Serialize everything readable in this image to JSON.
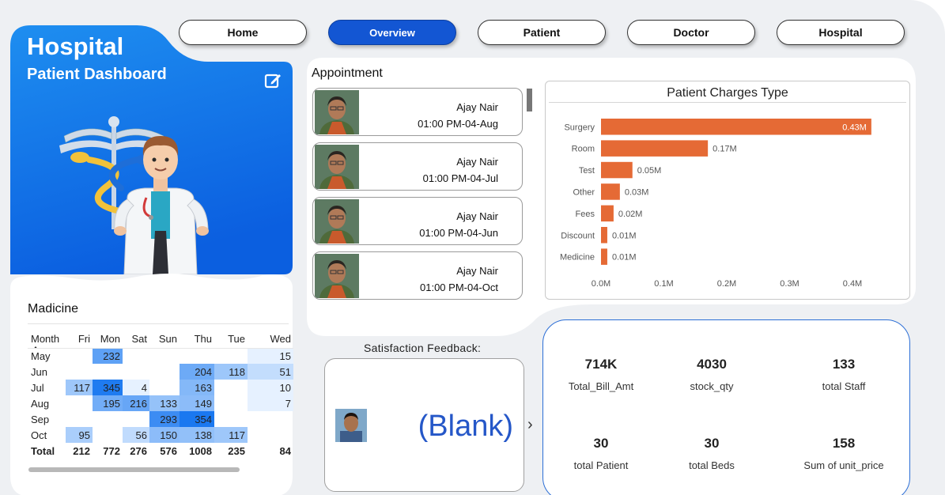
{
  "nav": {
    "items": [
      {
        "label": "Home",
        "active": false
      },
      {
        "label": "Overview",
        "active": true
      },
      {
        "label": "Patient",
        "active": false
      },
      {
        "label": "Doctor",
        "active": false
      },
      {
        "label": "Hospital",
        "active": false
      }
    ]
  },
  "hero": {
    "title": "Hospital",
    "subtitle": "Patient Dashboard",
    "gradient_start": "#1e8ef0",
    "gradient_end": "#0b5fe0",
    "edit_icon": "edit-icon"
  },
  "medicine": {
    "title": "Madicine",
    "columns": [
      "Month",
      "Fri",
      "Mon",
      "Sat",
      "Sun",
      "Thu",
      "Tue",
      "Wed"
    ],
    "rows": [
      {
        "month": "May",
        "values": [
          "",
          "232",
          "",
          "",
          "",
          "",
          "15"
        ]
      },
      {
        "month": "Jun",
        "values": [
          "",
          "",
          "",
          "",
          "204",
          "118",
          "51"
        ]
      },
      {
        "month": "Jul",
        "values": [
          "117",
          "345",
          "4",
          "",
          "163",
          "",
          "10"
        ]
      },
      {
        "month": "Aug",
        "values": [
          "",
          "195",
          "216",
          "133",
          "149",
          "",
          "7"
        ]
      },
      {
        "month": "Sep",
        "values": [
          "",
          "",
          "",
          "293",
          "354",
          "",
          ""
        ]
      },
      {
        "month": "Oct",
        "values": [
          "95",
          "",
          "56",
          "150",
          "138",
          "117",
          ""
        ]
      }
    ],
    "total": {
      "label": "Total",
      "values": [
        "212",
        "772",
        "276",
        "576",
        "1008",
        "235",
        "84"
      ]
    }
  },
  "appointment": {
    "title": "Appointment",
    "items": [
      {
        "name": "Ajay Nair",
        "time": "01:00 PM-04-Aug"
      },
      {
        "name": "Ajay Nair",
        "time": "01:00 PM-04-Jul"
      },
      {
        "name": "Ajay Nair",
        "time": "01:00 PM-04-Jun"
      },
      {
        "name": "Ajay Nair",
        "time": "01:00 PM-04-Oct"
      }
    ]
  },
  "chart_data": {
    "type": "bar",
    "orientation": "horizontal",
    "title": "Patient Charges Type",
    "categories": [
      "Surgery",
      "Room",
      "Test",
      "Other",
      "Fees",
      "Discount",
      "Medicine"
    ],
    "values": [
      0.43,
      0.17,
      0.05,
      0.03,
      0.02,
      0.01,
      0.01
    ],
    "value_labels": [
      "0.43M",
      "0.17M",
      "0.05M",
      "0.03M",
      "0.02M",
      "0.01M",
      "0.01M"
    ],
    "xlim": [
      0,
      0.43
    ],
    "ticks": [
      0,
      0.1,
      0.2,
      0.3,
      0.4
    ],
    "tick_labels": [
      "0.0M",
      "0.1M",
      "0.2M",
      "0.3M",
      "0.4M"
    ],
    "bar_color": "#e56a35",
    "grid": false,
    "xlabel": "",
    "ylabel": ""
  },
  "feedback": {
    "title": "Satisfaction Feedback:",
    "value": "(Blank)",
    "arrow": "›"
  },
  "kpis": [
    {
      "value": "714K",
      "label": "Total_Bill_Amt"
    },
    {
      "value": "4030",
      "label": "stock_qty"
    },
    {
      "value": "133",
      "label": "total Staff"
    },
    {
      "value": "30",
      "label": "total Patient"
    },
    {
      "value": "30",
      "label": "total Beds"
    },
    {
      "value": "158",
      "label": "Sum of unit_price"
    }
  ],
  "colors": {
    "accent": "#1356d3",
    "background": "#eef0f3",
    "heat_low": "#dfeeff",
    "heat_high": "#1a78f0"
  }
}
